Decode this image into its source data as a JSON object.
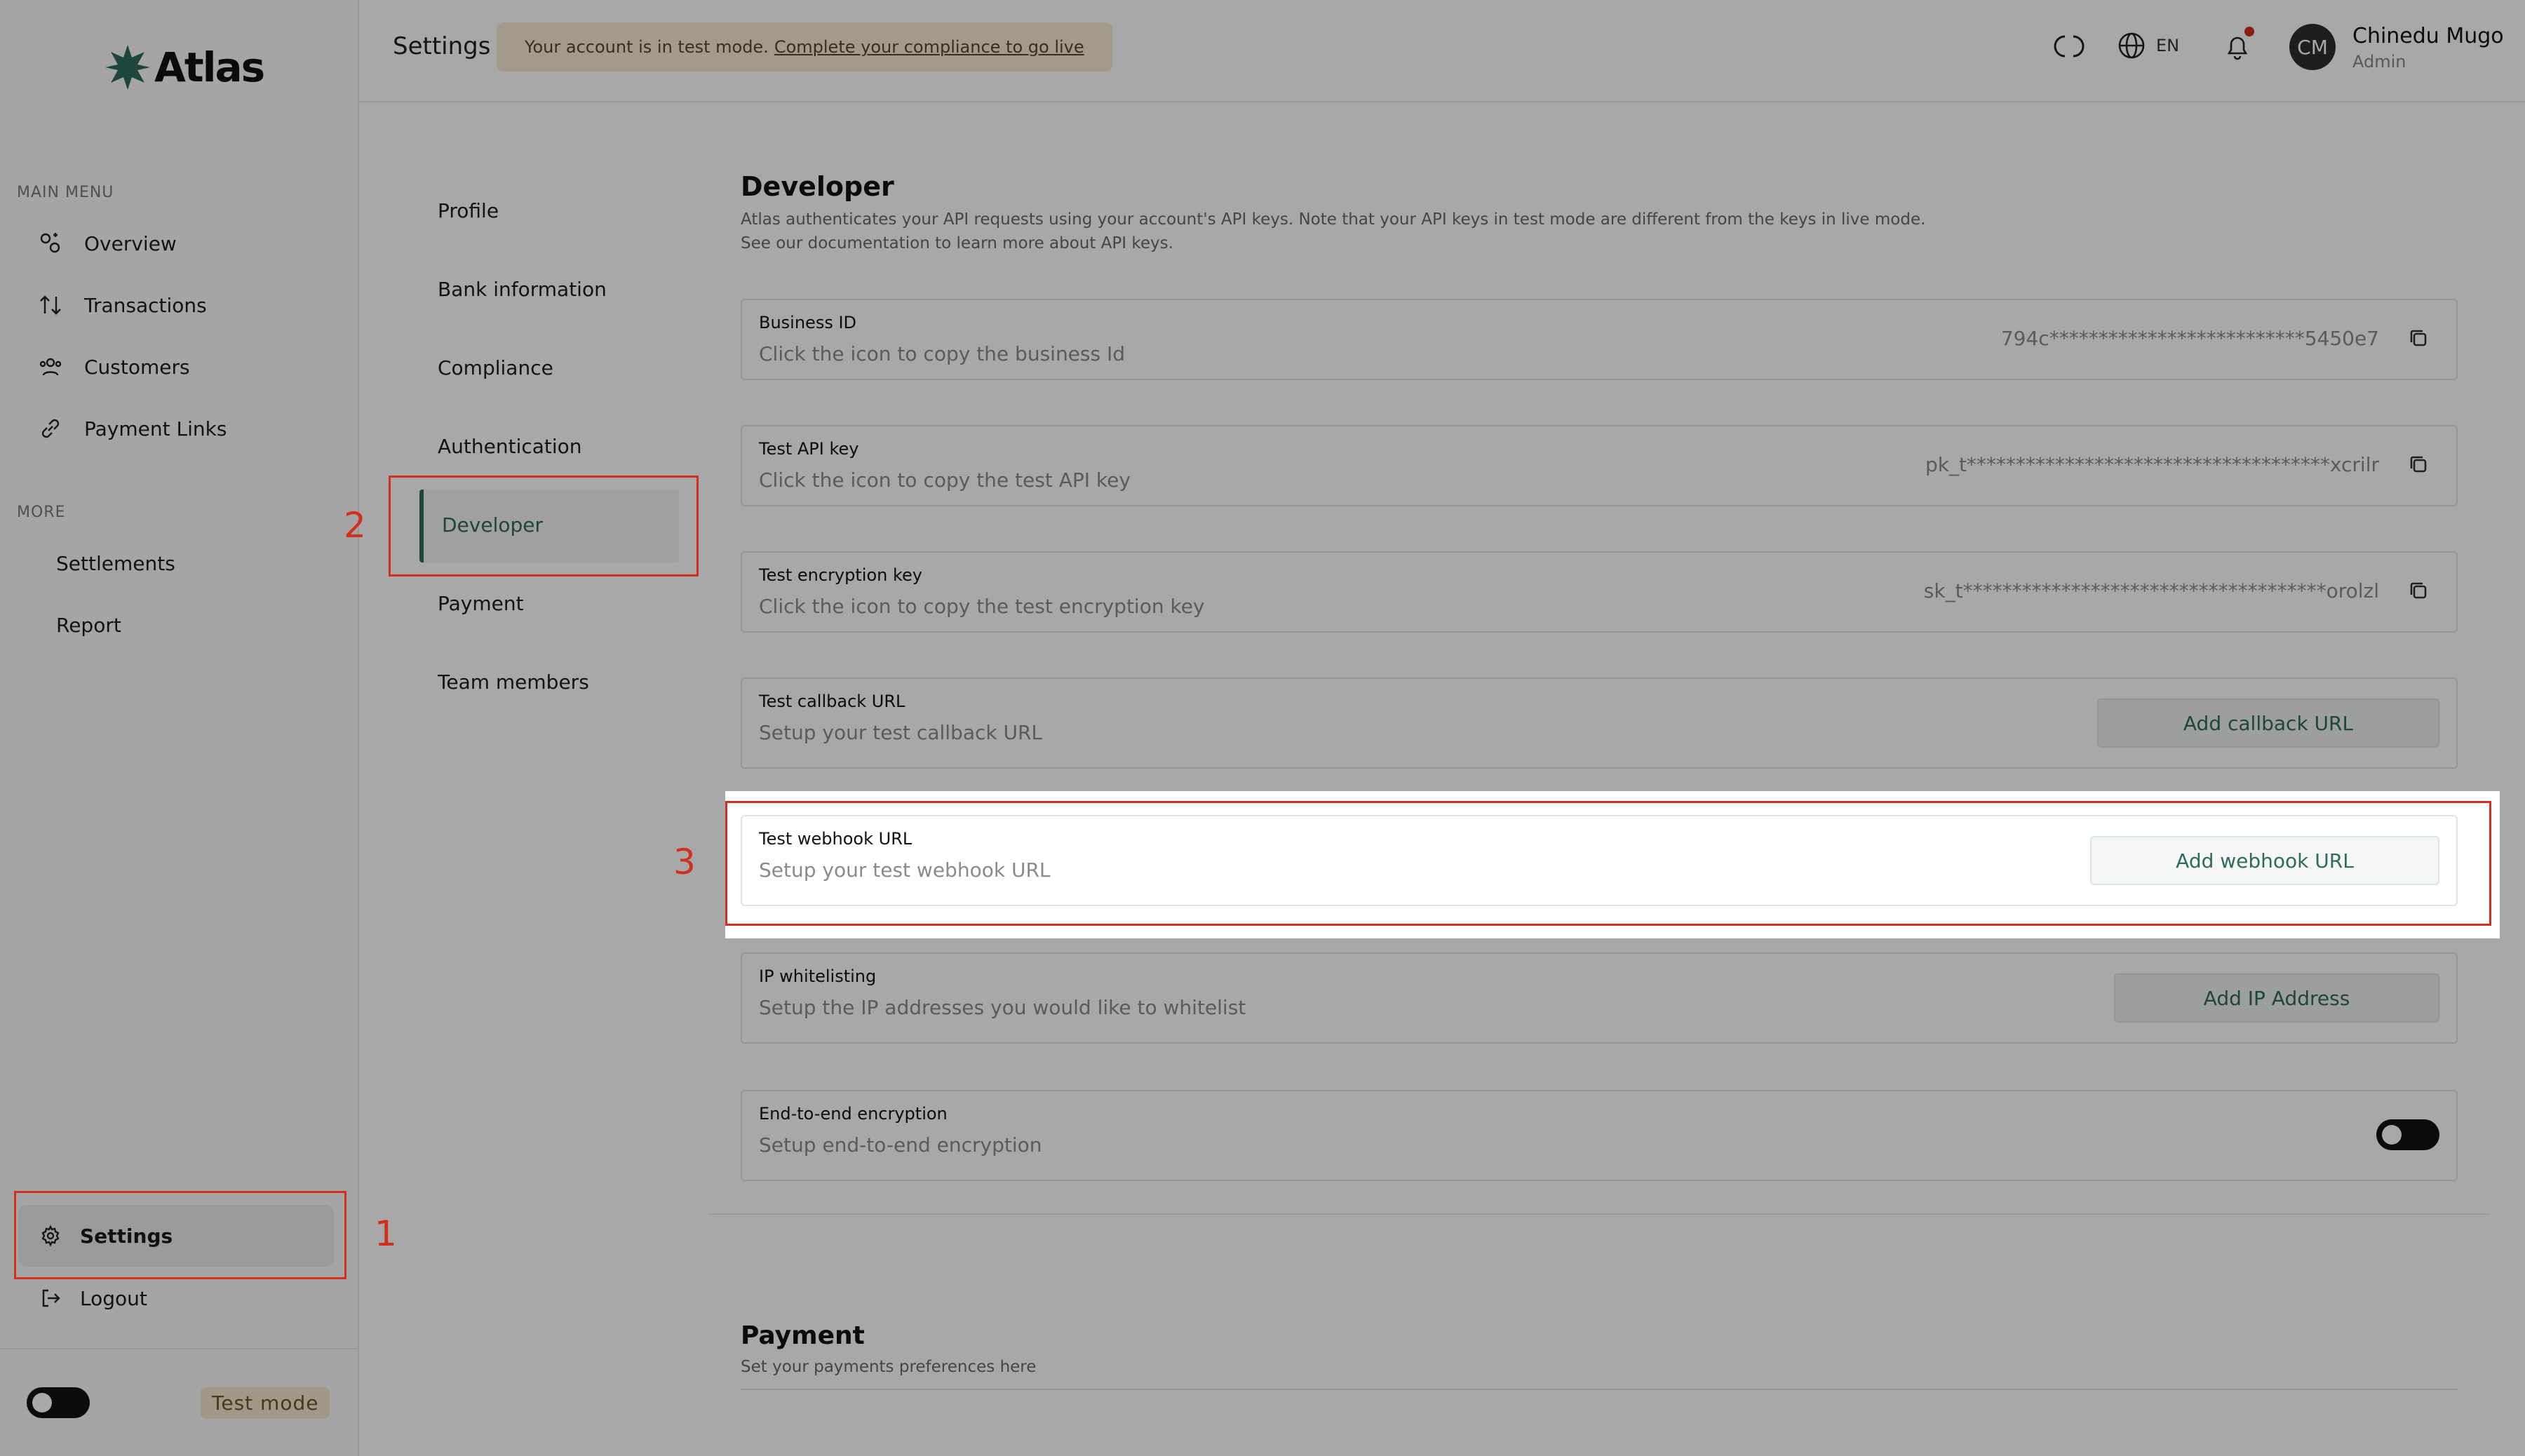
{
  "brand": {
    "name": "Atlas",
    "accent": "#2f6b5c"
  },
  "sidebar": {
    "main_menu_label": "MAIN MENU",
    "main_items": [
      {
        "label": "Overview",
        "icon": "overview-icon"
      },
      {
        "label": "Transactions",
        "icon": "transactions-icon"
      },
      {
        "label": "Customers",
        "icon": "customers-icon"
      },
      {
        "label": "Payment Links",
        "icon": "link-icon"
      }
    ],
    "more_label": "MORE",
    "more_items": [
      {
        "label": "Settlements"
      },
      {
        "label": "Report"
      }
    ],
    "settings_label": "Settings",
    "logout_label": "Logout",
    "test_mode_label": "Test mode"
  },
  "header": {
    "title": "Settings",
    "banner_text": "Your account is in test mode.",
    "banner_link": "Complete your compliance to go live",
    "language": "EN",
    "user": {
      "initials": "CM",
      "name": "Chinedu Mugo",
      "role": "Admin"
    }
  },
  "settings_nav": {
    "items": [
      "Profile",
      "Bank information",
      "Compliance",
      "Authentication",
      "Developer",
      "Payment",
      "Team members"
    ],
    "active": "Developer"
  },
  "developer": {
    "title": "Developer",
    "description_1": "Atlas authenticates your API requests using your account's API keys. Note that your API keys in test mode are different from the keys in live mode.",
    "description_2": "See our documentation to learn more about API keys.",
    "cards": {
      "business_id": {
        "label": "Business ID",
        "sub": "Click the icon to copy the business Id",
        "value": "794c**************************5450e7"
      },
      "test_api_key": {
        "label": "Test API key",
        "sub": "Click the icon to copy the test API key",
        "value": "pk_t*************************************xcrilr"
      },
      "test_encryption_key": {
        "label": "Test encryption key",
        "sub": "Click the icon to copy the test encryption key",
        "value": "sk_t*************************************orolzl"
      },
      "test_callback_url": {
        "label": "Test callback URL",
        "sub": "Setup your test callback URL",
        "button": "Add callback URL"
      },
      "test_webhook_url": {
        "label": "Test webhook URL",
        "sub": "Setup your test webhook URL",
        "button": "Add webhook URL"
      },
      "ip_whitelisting": {
        "label": "IP whitelisting",
        "sub": "Setup the IP addresses you would like to whitelist",
        "button": "Add IP Address"
      },
      "e2e_encryption": {
        "label": "End-to-end encryption",
        "sub": "Setup end-to-end encryption"
      }
    }
  },
  "payment": {
    "title": "Payment",
    "description": "Set your payments preferences here"
  },
  "annotations": {
    "step1": "1",
    "step2": "2",
    "step3": "3"
  }
}
